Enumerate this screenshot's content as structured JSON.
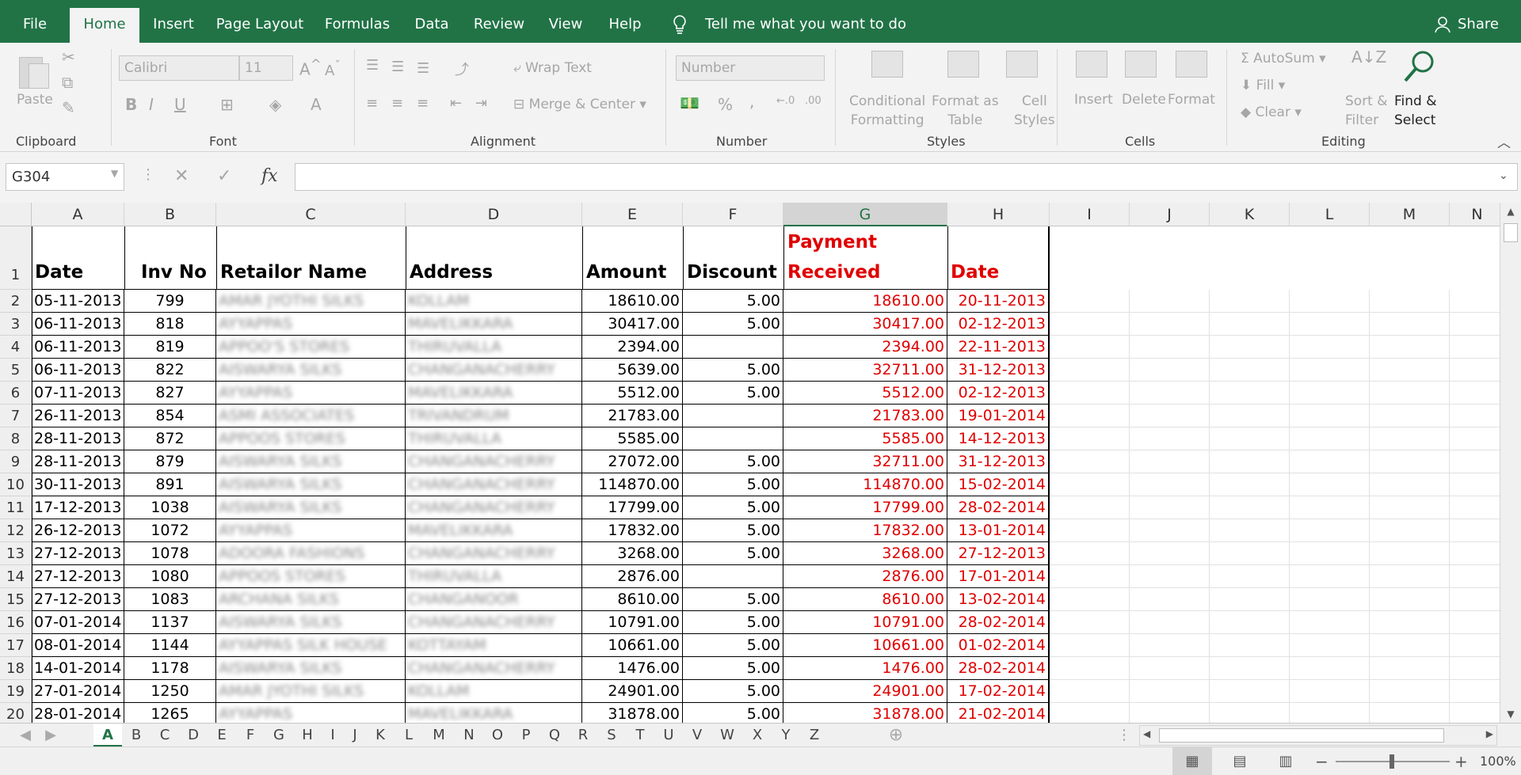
{
  "tabs": [
    {
      "label": "File",
      "active": false
    },
    {
      "label": "Home",
      "active": true
    },
    {
      "label": "Insert",
      "active": false
    },
    {
      "label": "Page Layout",
      "active": false
    },
    {
      "label": "Formulas",
      "active": false
    },
    {
      "label": "Data",
      "active": false
    },
    {
      "label": "Review",
      "active": false
    },
    {
      "label": "View",
      "active": false
    },
    {
      "label": "Help",
      "active": false
    }
  ],
  "tell_me": "Tell me what you want to do",
  "share": "Share",
  "ribbon": {
    "clipboard": {
      "paste": "Paste",
      "label": "Clipboard"
    },
    "font": {
      "name": "Calibri",
      "size": "11",
      "label": "Font"
    },
    "alignment": {
      "wrap": "Wrap Text",
      "merge": "Merge & Center",
      "label": "Alignment"
    },
    "number": {
      "format": "Number",
      "label": "Number",
      "percent": "%",
      "comma": ","
    },
    "styles": {
      "cond1": "Conditional",
      "cond2": "Formatting",
      "fmt1": "Format as",
      "fmt2": "Table",
      "cell1": "Cell",
      "cell2": "Styles",
      "label": "Styles"
    },
    "cells": {
      "insert": "Insert",
      "delete": "Delete",
      "format": "Format",
      "label": "Cells"
    },
    "editing": {
      "autosum": "AutoSum",
      "fill": "Fill",
      "clear": "Clear",
      "sort1": "Sort &",
      "sort2": "Filter",
      "find1": "Find &",
      "find2": "Select",
      "label": "Editing"
    }
  },
  "name_box": "G304",
  "fx": "fx",
  "columns": [
    "A",
    "B",
    "C",
    "D",
    "E",
    "F",
    "G",
    "H",
    "I",
    "J",
    "K",
    "L",
    "M",
    "N"
  ],
  "selected_column": "G",
  "header_row": {
    "row": "1",
    "date": "Date",
    "inv": "Inv No",
    "retailer": "Retailor Name",
    "address": "Address",
    "amount": "Amount",
    "discount": "Discount",
    "payment1": "Payment",
    "payment2": "Received",
    "pdate": "Date"
  },
  "rows": [
    {
      "n": "2",
      "date": "05-11-2013",
      "inv": "799",
      "retailer": "AMAR JYOTHI SILKS",
      "address": "KOLLAM",
      "amount": "18610.00",
      "discount": "5.00",
      "payment": "18610.00",
      "pdate": "20-11-2013"
    },
    {
      "n": "3",
      "date": "06-11-2013",
      "inv": "818",
      "retailer": "AYYAPPAS",
      "address": "MAVELIKKARA",
      "amount": "30417.00",
      "discount": "5.00",
      "payment": "30417.00",
      "pdate": "02-12-2013"
    },
    {
      "n": "4",
      "date": "06-11-2013",
      "inv": "819",
      "retailer": "APPOO'S STORES",
      "address": "THIRUVALLA",
      "amount": "2394.00",
      "discount": "",
      "payment": "2394.00",
      "pdate": "22-11-2013"
    },
    {
      "n": "5",
      "date": "06-11-2013",
      "inv": "822",
      "retailer": "AISWARYA SILKS",
      "address": "CHANGANACHERRY",
      "amount": "5639.00",
      "discount": "5.00",
      "payment": "32711.00",
      "pdate": "31-12-2013"
    },
    {
      "n": "6",
      "date": "07-11-2013",
      "inv": "827",
      "retailer": "AYYAPPAS",
      "address": "MAVELIKKARA",
      "amount": "5512.00",
      "discount": "5.00",
      "payment": "5512.00",
      "pdate": "02-12-2013"
    },
    {
      "n": "7",
      "date": "26-11-2013",
      "inv": "854",
      "retailer": "ASMI ASSOCIATES",
      "address": "TRIVANDRUM",
      "amount": "21783.00",
      "discount": "",
      "payment": "21783.00",
      "pdate": "19-01-2014"
    },
    {
      "n": "8",
      "date": "28-11-2013",
      "inv": "872",
      "retailer": "APPOOS STORES",
      "address": "THIRUVALLA",
      "amount": "5585.00",
      "discount": "",
      "payment": "5585.00",
      "pdate": "14-12-2013"
    },
    {
      "n": "9",
      "date": "28-11-2013",
      "inv": "879",
      "retailer": "AISWARYA SILKS",
      "address": "CHANGANACHERRY",
      "amount": "27072.00",
      "discount": "5.00",
      "payment": "32711.00",
      "pdate": "31-12-2013"
    },
    {
      "n": "10",
      "date": "30-11-2013",
      "inv": "891",
      "retailer": "AISWARYA SILKS",
      "address": "CHANGANACHERRY",
      "amount": "114870.00",
      "discount": "5.00",
      "payment": "114870.00",
      "pdate": "15-02-2014"
    },
    {
      "n": "11",
      "date": "17-12-2013",
      "inv": "1038",
      "retailer": "AISWARYA SILKS",
      "address": "CHANGANACHERRY",
      "amount": "17799.00",
      "discount": "5.00",
      "payment": "17799.00",
      "pdate": "28-02-2014"
    },
    {
      "n": "12",
      "date": "26-12-2013",
      "inv": "1072",
      "retailer": "AYYAPPAS",
      "address": "MAVELIKKARA",
      "amount": "17832.00",
      "discount": "5.00",
      "payment": "17832.00",
      "pdate": "13-01-2014"
    },
    {
      "n": "13",
      "date": "27-12-2013",
      "inv": "1078",
      "retailer": "ADOORA FASHIONS",
      "address": "CHANGANACHERRY",
      "amount": "3268.00",
      "discount": "5.00",
      "payment": "3268.00",
      "pdate": "27-12-2013"
    },
    {
      "n": "14",
      "date": "27-12-2013",
      "inv": "1080",
      "retailer": "APPOOS STORES",
      "address": "THIRUVALLA",
      "amount": "2876.00",
      "discount": "",
      "payment": "2876.00",
      "pdate": "17-01-2014"
    },
    {
      "n": "15",
      "date": "27-12-2013",
      "inv": "1083",
      "retailer": "ARCHANA SILKS",
      "address": "CHANGANOOR",
      "amount": "8610.00",
      "discount": "5.00",
      "payment": "8610.00",
      "pdate": "13-02-2014"
    },
    {
      "n": "16",
      "date": "07-01-2014",
      "inv": "1137",
      "retailer": "AISWARYA SILKS",
      "address": "CHANGANACHERRY",
      "amount": "10791.00",
      "discount": "5.00",
      "payment": "10791.00",
      "pdate": "28-02-2014"
    },
    {
      "n": "17",
      "date": "08-01-2014",
      "inv": "1144",
      "retailer": "AYYAPPAS SILK HOUSE",
      "address": "KOTTAYAM",
      "amount": "10661.00",
      "discount": "5.00",
      "payment": "10661.00",
      "pdate": "01-02-2014"
    },
    {
      "n": "18",
      "date": "14-01-2014",
      "inv": "1178",
      "retailer": "AISWARYA SILKS",
      "address": "CHANGANACHERRY",
      "amount": "1476.00",
      "discount": "5.00",
      "payment": "1476.00",
      "pdate": "28-02-2014"
    },
    {
      "n": "19",
      "date": "27-01-2014",
      "inv": "1250",
      "retailer": "AMAR JYOTHI SILKS",
      "address": "KOLLAM",
      "amount": "24901.00",
      "discount": "5.00",
      "payment": "24901.00",
      "pdate": "17-02-2014"
    },
    {
      "n": "20",
      "date": "28-01-2014",
      "inv": "1265",
      "retailer": "AYYAPPAS",
      "address": "MAVELIKKARA",
      "amount": "31878.00",
      "discount": "5.00",
      "payment": "31878.00",
      "pdate": "21-02-2014"
    }
  ],
  "sheet_tabs": [
    "A",
    "B",
    "C",
    "D",
    "E",
    "F",
    "G",
    "H",
    "I",
    "J",
    "K",
    "L",
    "M",
    "N",
    "O",
    "P",
    "Q",
    "R",
    "S",
    "T",
    "U",
    "V",
    "W",
    "X",
    "Y",
    "Z"
  ],
  "active_sheet": "A",
  "zoom": "100%",
  "colors": {
    "excel_green": "#217346",
    "red_text": "#e00000"
  }
}
